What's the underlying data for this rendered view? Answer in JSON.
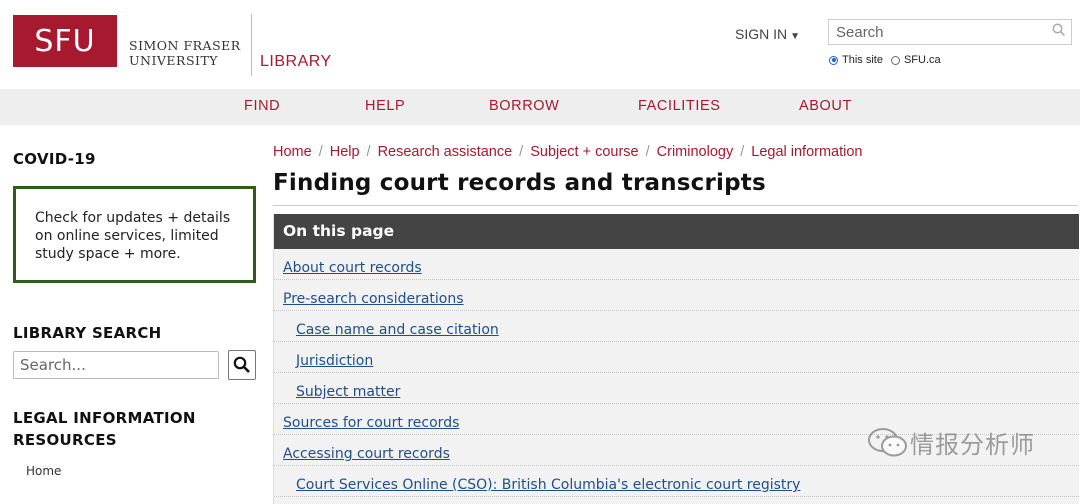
{
  "header": {
    "logo_mark": "SFU",
    "logo_line1": "SIMON FRASER",
    "logo_line2": "UNIVERSITY",
    "library_label": "LIBRARY",
    "signin_label": "SIGN IN",
    "search_placeholder": "Search",
    "radio_options": [
      {
        "label": "This site",
        "checked": true
      },
      {
        "label": "SFU.ca",
        "checked": false
      }
    ]
  },
  "nav": {
    "items": [
      "FIND",
      "HELP",
      "BORROW",
      "FACILITIES",
      "ABOUT"
    ]
  },
  "sidebar": {
    "covid_heading": "COVID-19",
    "covid_text": "Check for updates + details on online services, limited study space + more.",
    "library_search_heading": "LIBRARY SEARCH",
    "library_search_placeholder": "Search...",
    "legal_heading_line1": "LEGAL INFORMATION",
    "legal_heading_line2": "RESOURCES",
    "links": [
      "Home"
    ]
  },
  "main": {
    "breadcrumb": [
      "Home",
      "Help",
      "Research assistance",
      "Subject + course",
      "Criminology",
      "Legal information"
    ],
    "title": "Finding court records and transcripts",
    "toc_heading": "On this page",
    "toc_items": [
      {
        "label": "About court records",
        "level": 1
      },
      {
        "label": "Pre-search considerations",
        "level": 1
      },
      {
        "label": "Case name and case citation",
        "level": 2
      },
      {
        "label": "Jurisdiction",
        "level": 2
      },
      {
        "label": "Subject matter",
        "level": 2
      },
      {
        "label": "Sources for court records",
        "level": 1
      },
      {
        "label": "Accessing court records",
        "level": 1
      },
      {
        "label": "Court Services Online (CSO): British Columbia's electronic court registry",
        "level": 2
      }
    ]
  },
  "watermark": {
    "text": "情报分析师"
  },
  "colors": {
    "brand_red": "#a6192e",
    "covid_border": "#2c5e1a",
    "toc_header_bg": "#444444",
    "link_blue": "#1f4e8c"
  },
  "icons": {
    "search_top": "search-icon",
    "sidebar_search": "search-icon",
    "signin_caret": "caret-down-icon",
    "watermark": "wechat-icon"
  }
}
